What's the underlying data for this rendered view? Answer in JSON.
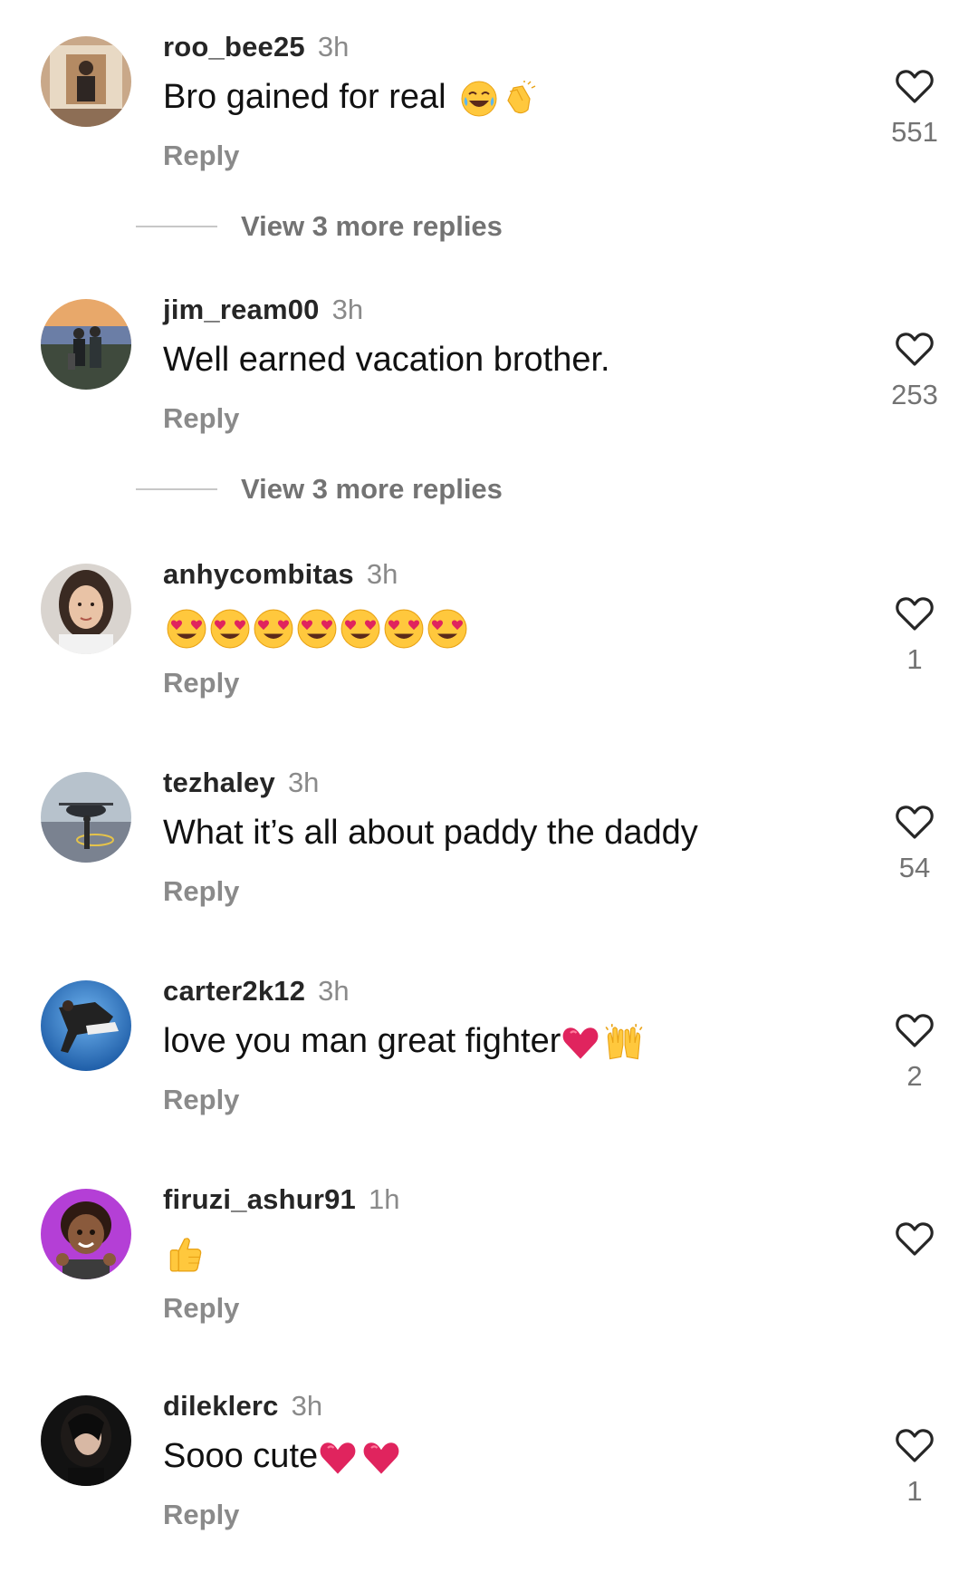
{
  "comments": [
    {
      "username": "roo_bee25",
      "time": "3h",
      "text": "Bro gained for real",
      "reply_label": "Reply",
      "likes": "551",
      "view_replies": "View 3 more replies",
      "text_emojis": [
        "joy-emoji",
        "clap-emoji"
      ]
    },
    {
      "username": "jim_ream00",
      "time": "3h",
      "text": "Well earned vacation brother.",
      "reply_label": "Reply",
      "likes": "253",
      "view_replies": "View 3 more replies"
    },
    {
      "username": "anhycombitas",
      "time": "3h",
      "text": "",
      "reply_label": "Reply",
      "likes": "1",
      "text_emojis": [
        "heart-eyes-emoji",
        "heart-eyes-emoji",
        "heart-eyes-emoji",
        "heart-eyes-emoji",
        "heart-eyes-emoji",
        "heart-eyes-emoji",
        "heart-eyes-emoji"
      ]
    },
    {
      "username": "tezhaley",
      "time": "3h",
      "text": "What it’s all about paddy the daddy",
      "reply_label": "Reply",
      "likes": "54"
    },
    {
      "username": "carter2k12",
      "time": "3h",
      "text": "love you man great fighter",
      "reply_label": "Reply",
      "likes": "2",
      "text_emojis": [
        "red-heart-emoji",
        "raising-hands-emoji"
      ]
    },
    {
      "username": "firuzi_ashur91",
      "time": "1h",
      "text": "",
      "reply_label": "Reply",
      "likes": "",
      "text_emojis": [
        "thumbs-up-emoji"
      ]
    },
    {
      "username": "dileklerc",
      "time": "3h",
      "text": "Sooo cute",
      "reply_label": "Reply",
      "likes": "1",
      "text_emojis": [
        "red-heart-emoji",
        "red-heart-emoji"
      ]
    }
  ],
  "colors": {
    "username": "#262626",
    "secondary_text": "#8a8a8a",
    "like_count": "#737373",
    "heart_outline": "#262626",
    "emoji_yellow": "#FFC83D",
    "heart_red": "#E0245E"
  },
  "icons": {
    "like": "heart-outline-icon"
  }
}
